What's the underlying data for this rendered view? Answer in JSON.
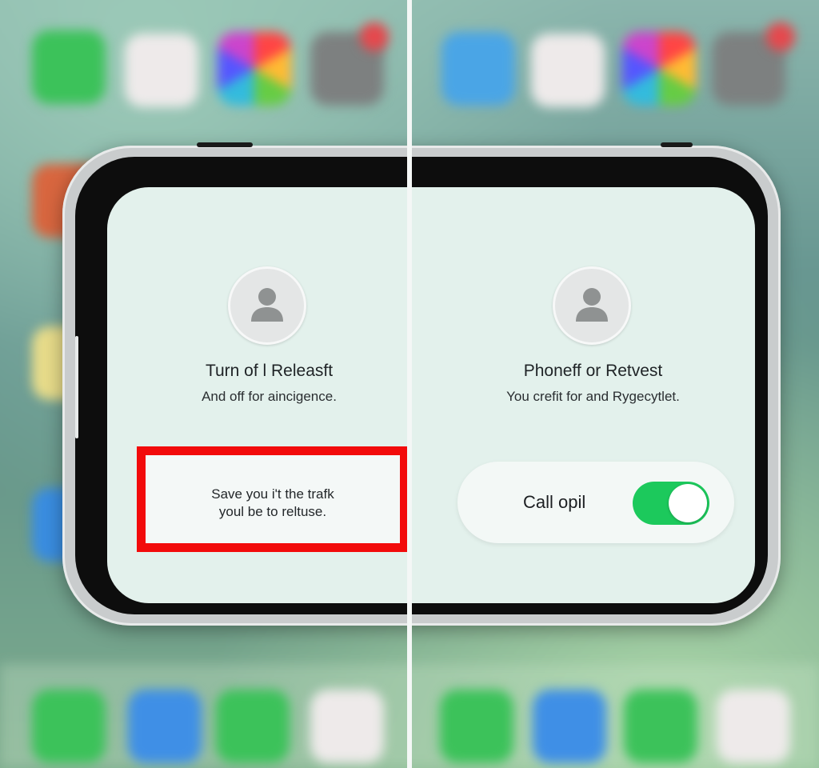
{
  "left_panel": {
    "title": "Turn of l Releasft",
    "subtitle": "And off for aincigence.",
    "highlight_text": "Save you i't the trafk\nyoul be to reltuse.",
    "avatar_icon": "person-icon"
  },
  "right_panel": {
    "title": "Phoneff or Retvest",
    "subtitle": "You crefit for and Rygecytlet.",
    "toggle_label": "Call opil",
    "toggle_on": true,
    "avatar_icon": "person-icon"
  },
  "colors": {
    "highlight_border": "#f20b0b",
    "toggle_on": "#1cc95c",
    "screen_background": "#e3f1ec"
  }
}
